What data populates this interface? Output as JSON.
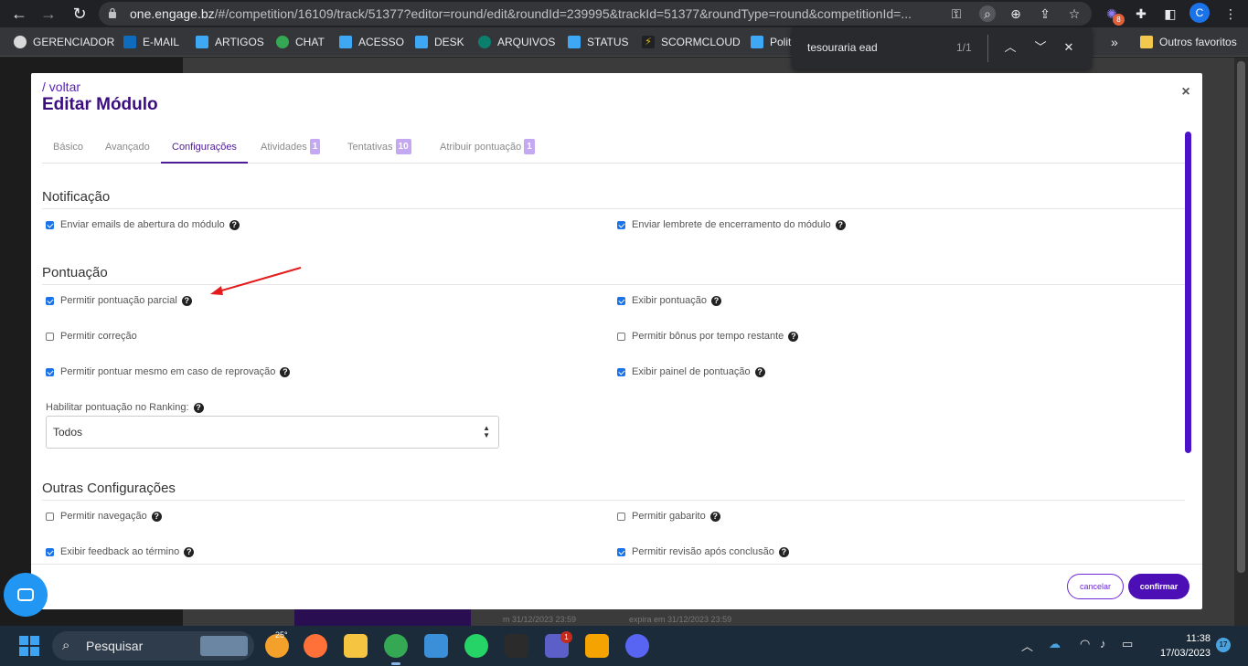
{
  "browser": {
    "url_host": "one.engage.bz",
    "url_path": "/#/competition/16109/track/51377?editor=round/edit&roundId=239995&trackId=51377&roundType=round&competitionId=...",
    "profile_initial": "C",
    "extension_badge": "8",
    "bookmarks": [
      "GERENCIADOR",
      "E-MAIL",
      "ARTIGOS",
      "CHAT",
      "ACESSO",
      "DESK",
      "ARQUIVOS",
      "STATUS",
      "SCORMCLOUD",
      "Polit"
    ],
    "bookmarks_overflow": "»",
    "other_bookmarks": "Outros favoritos",
    "find": {
      "query": "tesouraria ead",
      "count": "1/1"
    }
  },
  "modal": {
    "back_link": "/ voltar",
    "title": "Editar Módulo",
    "tabs": [
      {
        "label": "Básico",
        "badge": ""
      },
      {
        "label": "Avançado",
        "badge": ""
      },
      {
        "label": "Configurações",
        "badge": ""
      },
      {
        "label": "Atividades",
        "badge": "1"
      },
      {
        "label": "Tentativas",
        "badge": "10"
      },
      {
        "label": "Atribuir pontuação",
        "badge": "1"
      }
    ],
    "active_tab": "Configurações",
    "sections": {
      "notificacao": {
        "title": "Notificação",
        "options": [
          {
            "label": "Enviar emails de abertura do módulo",
            "checked": true,
            "help": true
          },
          {
            "label": "Enviar lembrete de encerramento do módulo",
            "checked": true,
            "help": true
          }
        ]
      },
      "pontuacao": {
        "title": "Pontuação",
        "options": [
          {
            "label": "Permitir pontuação parcial",
            "checked": true,
            "help": true
          },
          {
            "label": "Exibir pontuação",
            "checked": true,
            "help": true
          },
          {
            "label": "Permitir correção",
            "checked": false,
            "help": false
          },
          {
            "label": "Permitir bônus por tempo restante",
            "checked": false,
            "help": true
          },
          {
            "label": "Permitir pontuar mesmo em caso de reprovação",
            "checked": true,
            "help": true
          },
          {
            "label": "Exibir painel de pontuação",
            "checked": true,
            "help": true
          }
        ],
        "ranking_label": "Habilitar pontuação no Ranking:",
        "ranking_value": "Todos"
      },
      "outras": {
        "title": "Outras Configurações",
        "options": [
          {
            "label": "Permitir navegação",
            "checked": false,
            "help": true
          },
          {
            "label": "Permitir gabarito",
            "checked": false,
            "help": true
          },
          {
            "label": "Exibir feedback ao término",
            "checked": true,
            "help": true
          },
          {
            "label": "Permitir revisão após conclusão",
            "checked": true,
            "help": true
          }
        ]
      }
    },
    "cancel_label": "cancelar",
    "confirm_label": "confirmar",
    "close_glyph": "×",
    "help_glyph": "?"
  },
  "background": {
    "expiry_left": "m 31/12/2023 23:59",
    "expiry_right": "expira em 31/12/2023 23:59"
  },
  "taskbar": {
    "search_placeholder": "Pesquisar",
    "weather": "25°",
    "teams_badge": "1",
    "time": "11:38",
    "date": "17/03/2023",
    "notifications": "17"
  },
  "colors": {
    "accent": "#4c1d95",
    "badge": "#c4a8f2",
    "confirm": "#4c0fb5",
    "checkbox": "#1a73e8",
    "annotation_arrow": "#e31b1b"
  }
}
